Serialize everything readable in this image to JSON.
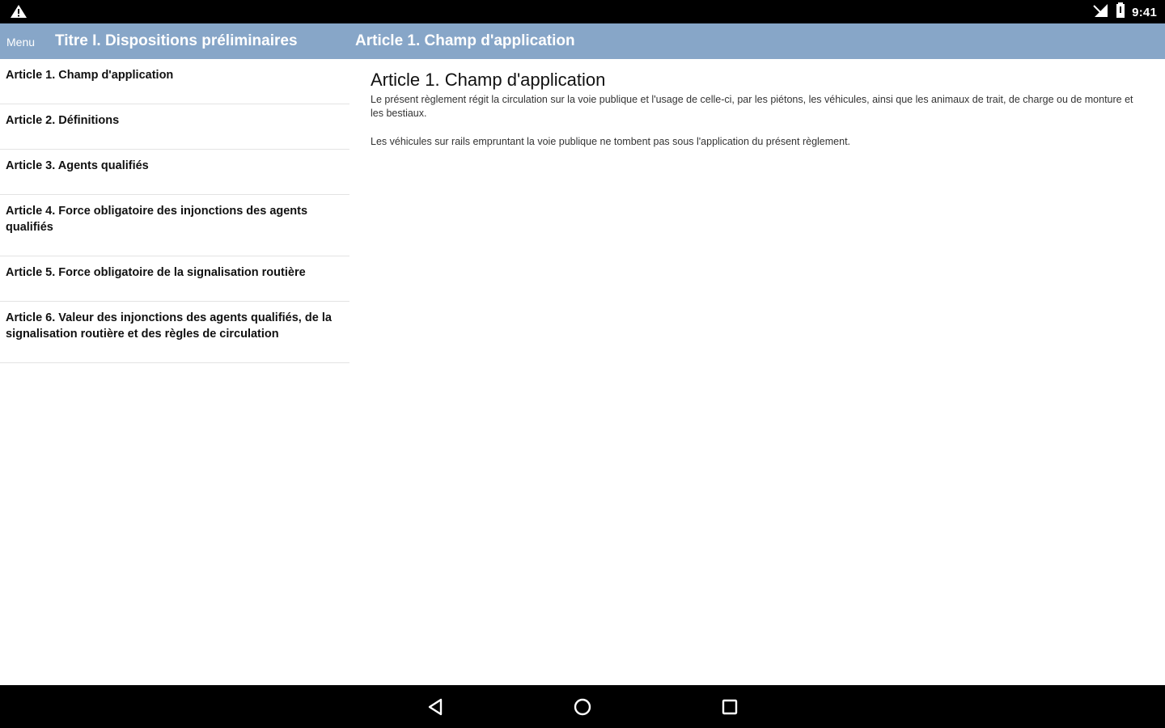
{
  "status_bar": {
    "time": "9:41",
    "icons": [
      "warning-icon",
      "signal-icon",
      "battery-icon"
    ]
  },
  "app_bar": {
    "menu_label": "Menu",
    "left_title": "Titre I. Dispositions préliminaires",
    "right_title": "Article 1. Champ d'application"
  },
  "articles": [
    {
      "label": "Article 1. Champ d'application"
    },
    {
      "label": "Article 2. Définitions"
    },
    {
      "label": "Article 3. Agents qualifiés"
    },
    {
      "label": "Article 4. Force obligatoire des injonctions des agents qualifiés"
    },
    {
      "label": "Article 5. Force obligatoire de la signalisation routière"
    },
    {
      "label": "Article 6. Valeur des injonctions des agents qualifiés, de la signalisation routière et des règles de circulation"
    }
  ],
  "content": {
    "title": "Article 1. Champ d'application",
    "paragraphs": [
      "Le présent règlement régit la circulation sur la voie publique et l'usage de celle-ci, par les piétons, les véhicules, ainsi que les animaux de trait, de charge ou de monture et les bestiaux.",
      "Les véhicules sur rails empruntant la voie publique ne tombent pas sous l'application du présent règlement."
    ]
  },
  "nav_bar": {
    "buttons": [
      "back-icon",
      "home-icon",
      "recents-icon"
    ]
  },
  "colors": {
    "app_bar": "#87a6c8",
    "status_bar": "#000000",
    "nav_bar": "#000000"
  }
}
